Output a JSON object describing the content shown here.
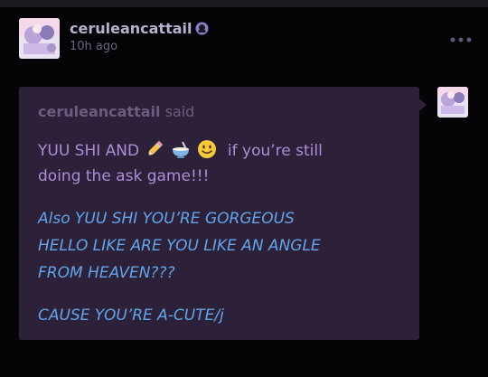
{
  "post": {
    "username": "ceruleancattail",
    "timestamp": "10h ago"
  },
  "ask": {
    "asker_name": "ceruleancattail",
    "said_word": "said",
    "question": {
      "line1_text": "YUU SHI AND",
      "line1_suffix": "if you’re still",
      "line2": "doing the ask game!!!",
      "emojis": [
        "pencil-icon",
        "bowl-icon",
        "smile-icon"
      ]
    },
    "answer_lines": [
      "Also YUU SHI YOU’RE GORGEOUS",
      "HELLO LIKE ARE YOU LIKE AN ANGLE",
      "FROM HEAVEN???",
      "CAUSE YOU’RE A-CUTE/j"
    ]
  },
  "colors": {
    "background": "#050407",
    "ask_bubble": "#2d2139",
    "question_text": "#ac8ed8",
    "answer_text": "#63a4ea"
  }
}
